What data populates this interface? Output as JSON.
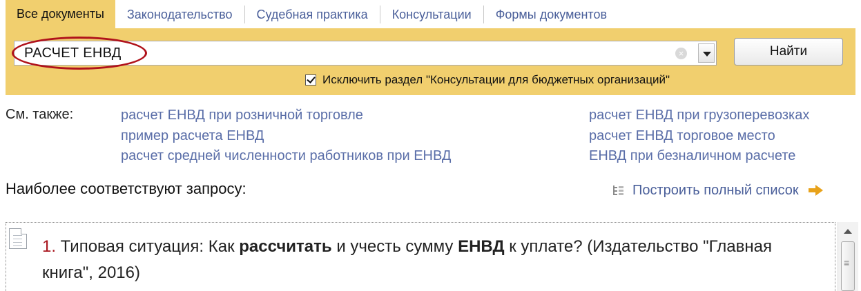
{
  "tabs": [
    {
      "label": "Все документы",
      "active": true
    },
    {
      "label": "Законодательство",
      "active": false
    },
    {
      "label": "Судебная практика",
      "active": false
    },
    {
      "label": "Консультации",
      "active": false
    },
    {
      "label": "Формы документов",
      "active": false
    }
  ],
  "search": {
    "value": "РАСЧЕТ ЕНВД",
    "find_label": "Найти",
    "exclude_label": "Исключить раздел \"Консультации для бюджетных организаций\"",
    "exclude_checked": true,
    "clear_glyph": "×"
  },
  "see_also": {
    "label": "См. также:",
    "col1": [
      "расчет ЕНВД при розничной торговле",
      "пример расчета ЕНВД",
      "расчет средней численности работников при ЕНВД"
    ],
    "col2": [
      "расчет ЕНВД при грузоперевозках",
      "расчет ЕНВД торговое место",
      "ЕНВД при безналичном расчете"
    ]
  },
  "results": {
    "title": "Наиболее соответствуют запросу:",
    "full_list_label": "Построить полный список",
    "items": [
      {
        "number": "1.",
        "parts": [
          {
            "text": " Типовая ситуация: Как ",
            "bold": false
          },
          {
            "text": "рассчитать",
            "bold": true
          },
          {
            "text": " и учесть сумму ",
            "bold": false
          },
          {
            "text": "ЕНВД",
            "bold": true
          },
          {
            "text": " к уплате? (Издательство \"Главная книга\", 2016)",
            "bold": false
          }
        ]
      }
    ]
  },
  "colors": {
    "band": "#f1cf6e",
    "link": "#5a6ea8",
    "highlight": "#b0121b",
    "result_number": "#a8141c",
    "arrow": "#e8a21a"
  }
}
